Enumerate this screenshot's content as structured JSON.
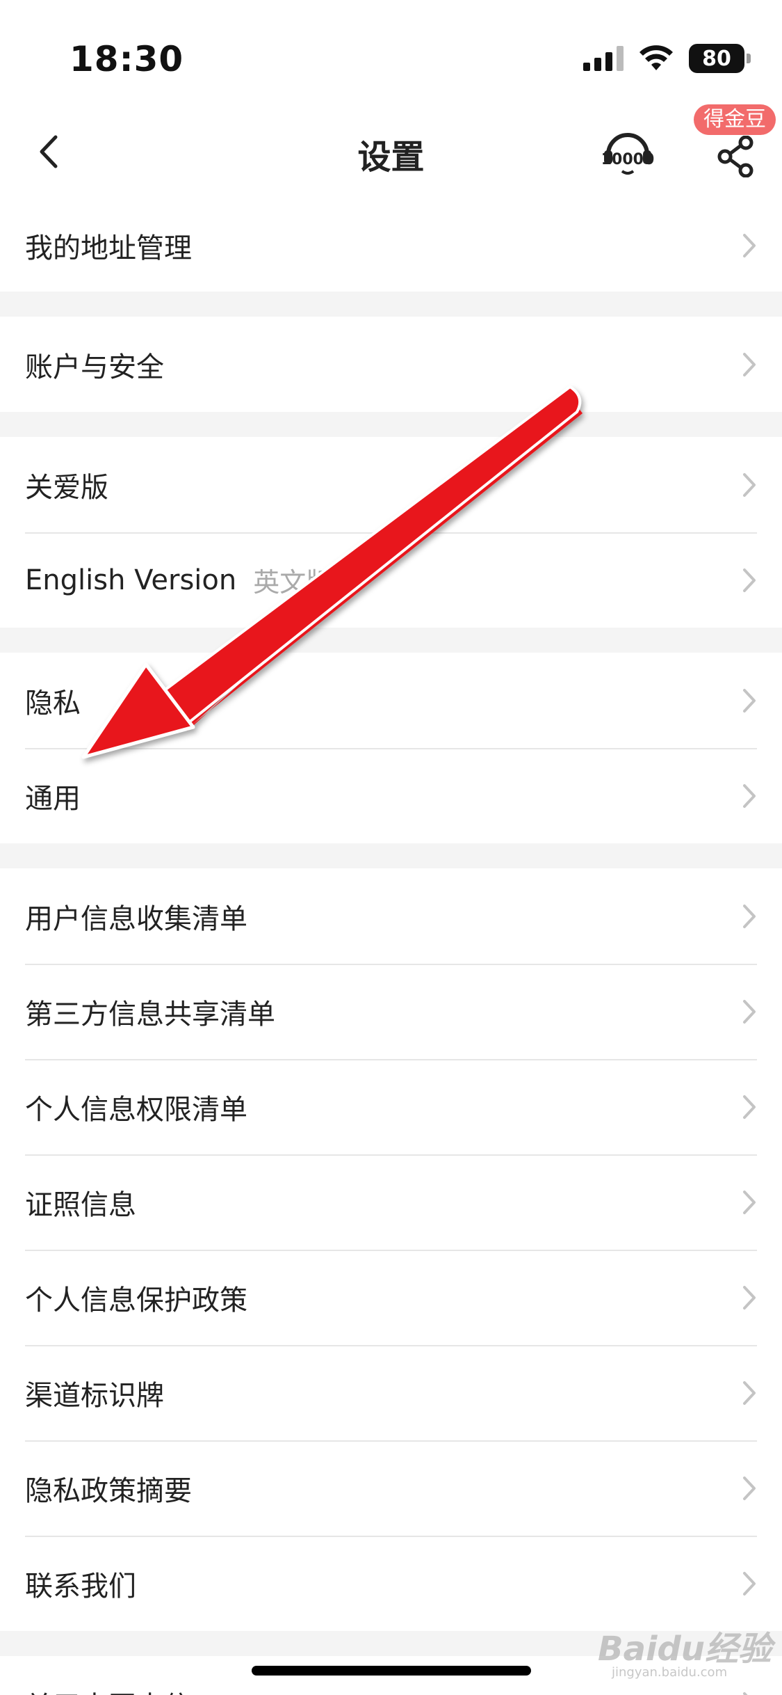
{
  "status_bar": {
    "time": "18:30",
    "battery": "80"
  },
  "nav": {
    "title": "设置",
    "badge": "得金豆",
    "back_icon": "chevron-left-icon",
    "service_icon": "customer-service-10000-icon",
    "share_icon": "share-icon"
  },
  "groups": [
    {
      "items": [
        {
          "label": "我的地址管理"
        }
      ]
    },
    {
      "items": [
        {
          "label": "账户与安全"
        }
      ]
    },
    {
      "items": [
        {
          "label": "关爱版"
        },
        {
          "label": "English Version",
          "sub": "英文版"
        }
      ]
    },
    {
      "items": [
        {
          "label": "隐私"
        },
        {
          "label": "通用"
        }
      ]
    },
    {
      "items": [
        {
          "label": "用户信息收集清单"
        },
        {
          "label": "第三方信息共享清单"
        },
        {
          "label": "个人信息权限清单"
        },
        {
          "label": "证照信息"
        },
        {
          "label": "个人信息保护政策"
        },
        {
          "label": "渠道标识牌"
        },
        {
          "label": "隐私政策摘要"
        },
        {
          "label": "联系我们"
        }
      ]
    },
    {
      "items": [
        {
          "label": "关于中国电信APP"
        }
      ]
    }
  ],
  "watermark": {
    "brand": "Baidu经验",
    "url": "jingyan.baidu.com"
  },
  "colors": {
    "accent_red": "#e8141a",
    "badge": "#f26b6b"
  }
}
